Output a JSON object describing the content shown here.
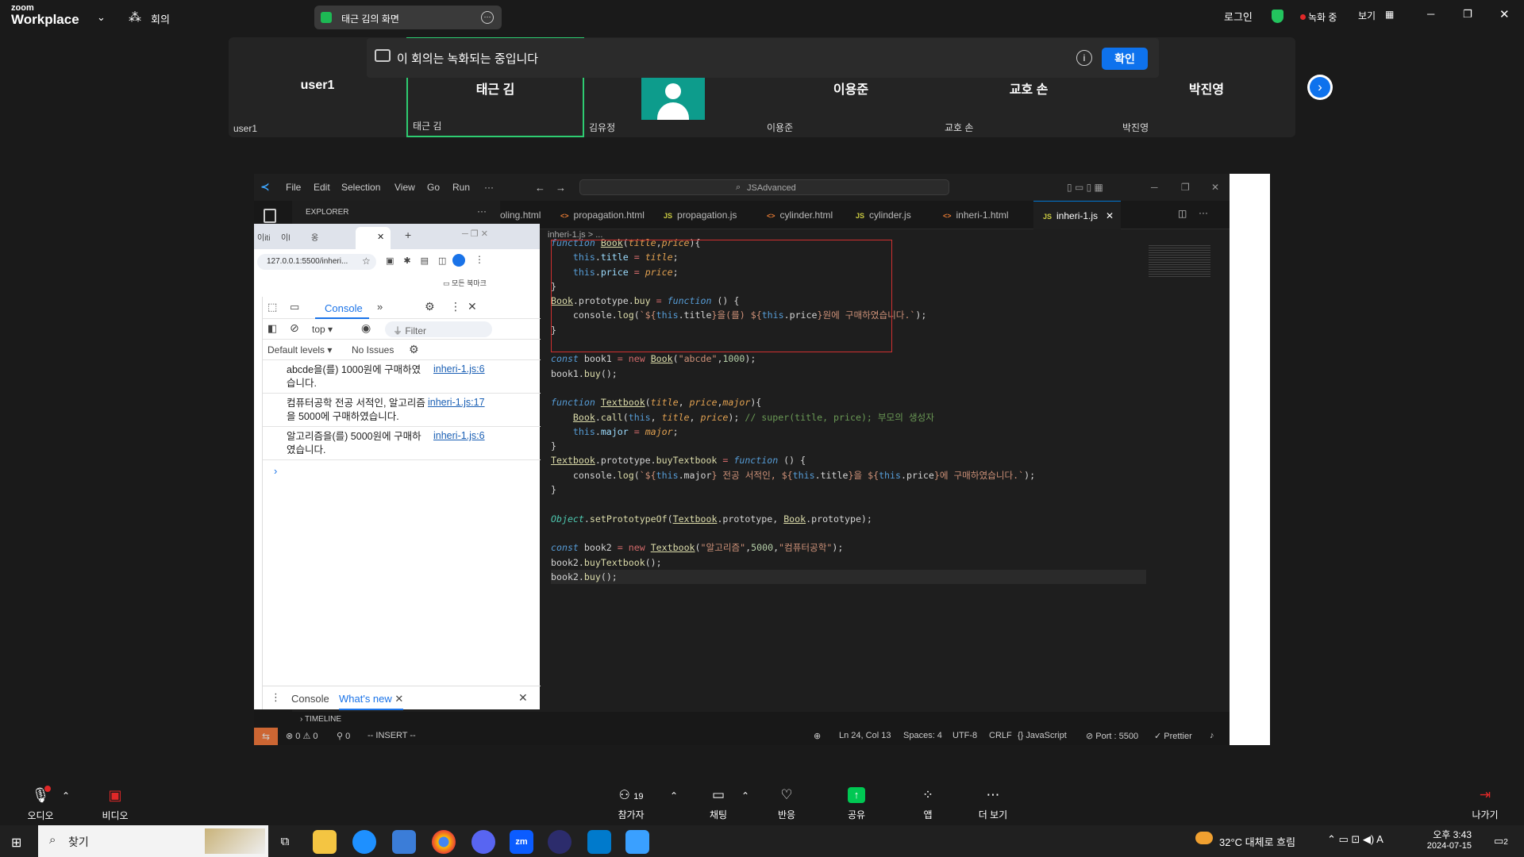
{
  "zoom": {
    "logo_small": "zoom",
    "logo_big": "Workplace",
    "meeting_label": "회의",
    "share_title": "태근 김의 화면",
    "login": "로그인",
    "recording": "녹화 중",
    "view": "보기",
    "record_banner": "이 회의는 녹화되는 중입니다",
    "confirm": "확인",
    "participants": [
      {
        "name": "user1",
        "label": "user1"
      },
      {
        "name": "태근 김",
        "label": "태근 김"
      },
      {
        "name": "",
        "label": "김유정"
      },
      {
        "name": "이용준",
        "label": "이용준"
      },
      {
        "name": "교호 손",
        "label": "교호 손"
      },
      {
        "name": "박진영",
        "label": "박진영"
      }
    ],
    "bottom": {
      "audio": "오디오",
      "video": "비디오",
      "participants": "참가자",
      "participants_count": "19",
      "chat": "채팅",
      "react": "반응",
      "share": "공유",
      "apps": "앱",
      "more": "더 보기",
      "leave": "나가기"
    }
  },
  "vscode": {
    "menu": [
      "File",
      "Edit",
      "Selection",
      "View",
      "Go",
      "Run",
      "···"
    ],
    "search": "JSAdvanced",
    "explorer": "EXPLORER",
    "tabs": [
      {
        "icon": "",
        "label": "oling.html"
      },
      {
        "icon": "<>",
        "label": "propagation.html"
      },
      {
        "icon": "JS",
        "label": "propagation.js"
      },
      {
        "icon": "<>",
        "label": "cylinder.html"
      },
      {
        "icon": "JS",
        "label": "cylinder.js"
      },
      {
        "icon": "<>",
        "label": "inheri-1.html"
      },
      {
        "icon": "JS",
        "label": "inheri-1.js"
      }
    ],
    "breadcrumb": "inheri-1.js > ...",
    "timeline": "TIMELINE",
    "status": {
      "errors": "0",
      "warnings": "0",
      "ports": "0",
      "mode": "-- INSERT --",
      "position": "Ln 24, Col 13",
      "spaces": "Spaces: 4",
      "encoding": "UTF-8",
      "eol": "CRLF",
      "language": "JavaScript",
      "port": "Port : 5500",
      "prettier": "Prettier"
    }
  },
  "chrome": {
    "tabs": [
      "이iti",
      "이l",
      "옹"
    ],
    "url": "127.0.0.1:5500/inheri...",
    "bookmarks": "모든 북마크",
    "devtools": {
      "tab_console": "Console",
      "context": "top",
      "filter": "Filter",
      "levels": "Default levels",
      "issues": "No Issues",
      "messages": [
        {
          "text": "abcde을(를) 1000원에 구매하였습니다.",
          "source": "inheri-1.js:6"
        },
        {
          "text": "컴퓨터공학 전공 서적인, 알고리즘을 5000에 구매하였습니다.",
          "source": "inheri-1.js:17"
        },
        {
          "text": "알고리즘을(를) 5000원에 구매하였습니다.",
          "source": "inheri-1.js:6"
        }
      ],
      "drawer_console": "Console",
      "drawer_whats_new": "What's new"
    }
  },
  "taskbar": {
    "search": "찾기",
    "weather": "32°C 대체로 흐림",
    "time": "오후 3:43",
    "date": "2024-07-15",
    "notif": "2"
  },
  "colors": {
    "zoom_blue": "#0e72ed",
    "rec_red": "#e02828",
    "share_green": "#00c853",
    "vscode_status_orange": "#cc6633"
  }
}
